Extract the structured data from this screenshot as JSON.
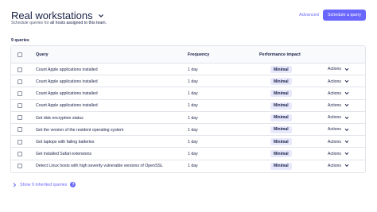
{
  "header": {
    "title": "Real workstations",
    "subtitle_prefix": "Schedule queries for",
    "subtitle_strong": "all hosts assigned to this team.",
    "advanced_label": "Advanced",
    "schedule_button_label": "Schedule a query"
  },
  "query_count": "9 queries",
  "table": {
    "columns": [
      "Query",
      "Frequency",
      "Performance impact"
    ],
    "rows": [
      {
        "query": "Count Apple applications installed",
        "frequency": "1 day",
        "impact": "Minimal",
        "actions": "Actions"
      },
      {
        "query": "Count Apple applications installed",
        "frequency": "1 day",
        "impact": "Minimal",
        "actions": "Actions"
      },
      {
        "query": "Count Apple applications installed",
        "frequency": "1 day",
        "impact": "Minimal",
        "actions": "Actions"
      },
      {
        "query": "Count Apple applications installed",
        "frequency": "1 day",
        "impact": "Minimal",
        "actions": "Actions"
      },
      {
        "query": "Get disk encryption status",
        "frequency": "1 day",
        "impact": "Minimal",
        "actions": "Actions"
      },
      {
        "query": "Get the version of the resident operating system",
        "frequency": "1 day",
        "impact": "Minimal",
        "actions": "Actions"
      },
      {
        "query": "Get laptops with failing batteries",
        "frequency": "1 day",
        "impact": "Minimal",
        "actions": "Actions"
      },
      {
        "query": "Get installed Safari extensions",
        "frequency": "1 day",
        "impact": "Minimal",
        "actions": "Actions"
      },
      {
        "query": "Detect Linux hosts with high severity vulnerable versions of OpenSSL",
        "frequency": "1 day",
        "impact": "Minimal",
        "actions": "Actions"
      }
    ]
  },
  "inherited": {
    "label": "Show 9 inherited queries",
    "help_icon_glyph": "?"
  },
  "colors": {
    "accent": "#6a67fe",
    "text": "#192147",
    "badge_bg": "#e9e9fd",
    "border": "#e2e4ea"
  }
}
